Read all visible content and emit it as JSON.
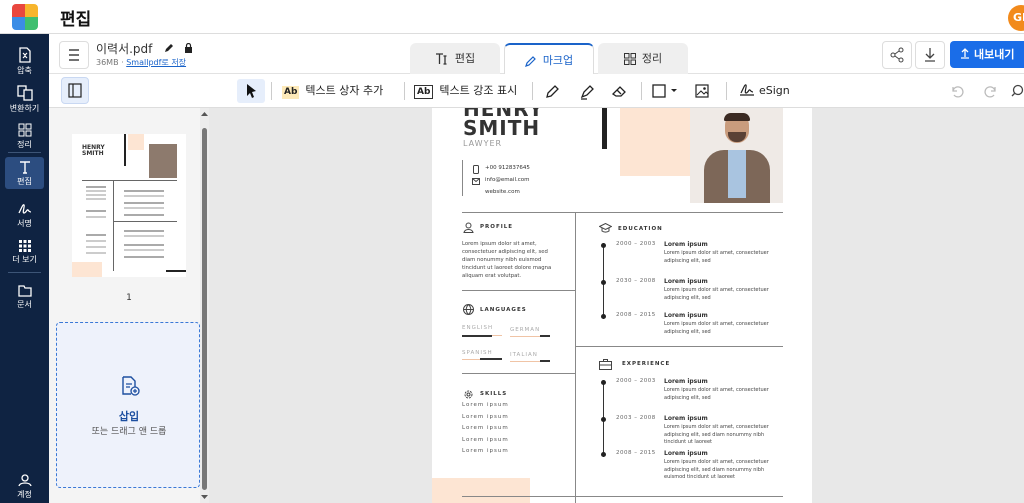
{
  "app": {
    "title": "편집",
    "avatar": "GI"
  },
  "colors": {
    "accent": "#1a63c9",
    "rail": "#0f2342",
    "peach": "#fde5d3"
  },
  "rail": [
    {
      "label": "압축",
      "icon": "compress-icon"
    },
    {
      "label": "변환하기",
      "icon": "convert-icon"
    },
    {
      "label": "정리",
      "icon": "organize-icon"
    },
    {
      "label": "편집",
      "icon": "edit-icon"
    },
    {
      "label": "서명",
      "icon": "sign-icon"
    },
    {
      "label": "더 보기",
      "icon": "more-icon"
    },
    {
      "label": "문서",
      "icon": "documents-icon"
    },
    {
      "label": "계정",
      "icon": "account-icon"
    }
  ],
  "file": {
    "name": "이력서.pdf",
    "size": "36MB",
    "save_link": "Smallpdf로 저장"
  },
  "tabs": [
    {
      "label": "편집"
    },
    {
      "label": "마크업"
    },
    {
      "label": "정리"
    }
  ],
  "export_label": "내보내기",
  "toolbar": {
    "add_textbox": "텍스트 상자 추가",
    "highlight_text": "텍스트 강조 표시",
    "esign": "eSign"
  },
  "sidebar": {
    "page_number": "1",
    "insert_title": "삽입",
    "insert_hint": "또는 드래그 앤 드롭"
  },
  "resume": {
    "name1": "HENRY",
    "name2": "SMITH",
    "role": "LAWYER",
    "phone": "+00 912837645",
    "email": "info@email.com",
    "website": "website.com",
    "profile_h": "PROFILE",
    "profile_text": [
      "Lorem ipsum dolor sit amet,",
      "consectetuer adipiscing elit, sed",
      "diam nonummy nibh euismod",
      "tincidunt ut laoreet dolore magna",
      "aliquam erat volutpat."
    ],
    "languages_h": "LANGUAGES",
    "languages": [
      "ENGLISH",
      "GERMAN",
      "SPANISH",
      "ITALIAN"
    ],
    "skills_h": "SKILLS",
    "skills": [
      "Lorem ipsum",
      "Lorem ipsum",
      "Lorem ipsum",
      "Lorem ipsum",
      "Lorem ipsum"
    ],
    "education_h": "EDUCATION",
    "education": [
      {
        "years": "2000 – 2003",
        "title": "Lorem ipsum",
        "lines": [
          "Lorem ipsum dolor sit amet, consectetuer",
          "adipiscing elit, sed"
        ]
      },
      {
        "years": "2030 – 2008",
        "title": "Lorem ipsum",
        "lines": [
          "Lorem ipsum dolor sit amet, consectetuer",
          "adipiscing elit, sed"
        ]
      },
      {
        "years": "2008 – 2015",
        "title": "Lorem ipsum",
        "lines": [
          "Lorem ipsum dolor sit amet, consectetuer",
          "adipiscing elit, sed"
        ]
      }
    ],
    "experience_h": "EXPERIENCE",
    "experience": [
      {
        "years": "2000 – 2003",
        "title": "Lorem ipsum",
        "lines": [
          "Lorem ipsum dolor sit amet, consectetuer",
          "adipiscing elit, sed"
        ]
      },
      {
        "years": "2003 – 2008",
        "title": "Lorem ipsum",
        "lines": [
          "Lorem ipsum dolor sit amet, consectetuer",
          "adipiscing elit, sed diam nonummy nibh",
          "tincidunt ut laoreet"
        ]
      },
      {
        "years": "2008 – 2015",
        "title": "Lorem ipsum",
        "lines": [
          "Lorem ipsum dolor sit amet, consectetuer",
          "adipiscing elit, sed diam nonummy nibh",
          "euismod tincidunt ut laoreet"
        ]
      }
    ]
  }
}
